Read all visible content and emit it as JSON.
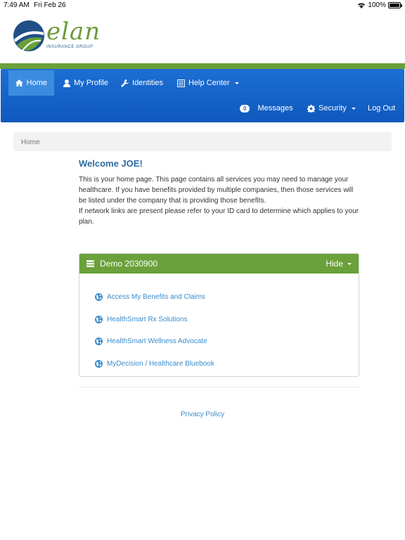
{
  "status_bar": {
    "time": "7:49 AM",
    "date": "Fri Feb 26",
    "battery": "100%"
  },
  "logo": {
    "word": "elan",
    "subtitle": "INSURANCE GROUP"
  },
  "nav": {
    "home": "Home",
    "profile": "My Profile",
    "identities": "Identities",
    "help_center": "Help Center",
    "messages_count": "0",
    "messages": "Messages",
    "security": "Security",
    "logout": "Log Out"
  },
  "breadcrumb": "Home",
  "welcome": {
    "title": "Welcome JOE!",
    "line1": "This is your home page. This page contains all services you may need to manage your healthcare. If you have benefits provided by multiple companies, then those services will be listed under the company that is providing those benefits.",
    "line2": "If network links are present please refer to your ID card to determine which applies to your plan."
  },
  "panel": {
    "title": "Demo 2030900",
    "toggle": "Hide",
    "links": [
      "Access My Benefits and Claims",
      "HealthSmart Rx Solutions",
      "HealthSmart Wellness Advocate",
      "MyDecision / Healthcare Bluebook"
    ]
  },
  "footer": {
    "privacy": "Privacy Policy"
  },
  "colors": {
    "brand_green": "#6aa13a",
    "nav_blue": "#1d6fd3",
    "link_blue": "#3a8ccc",
    "title_blue": "#2d6ca2"
  }
}
